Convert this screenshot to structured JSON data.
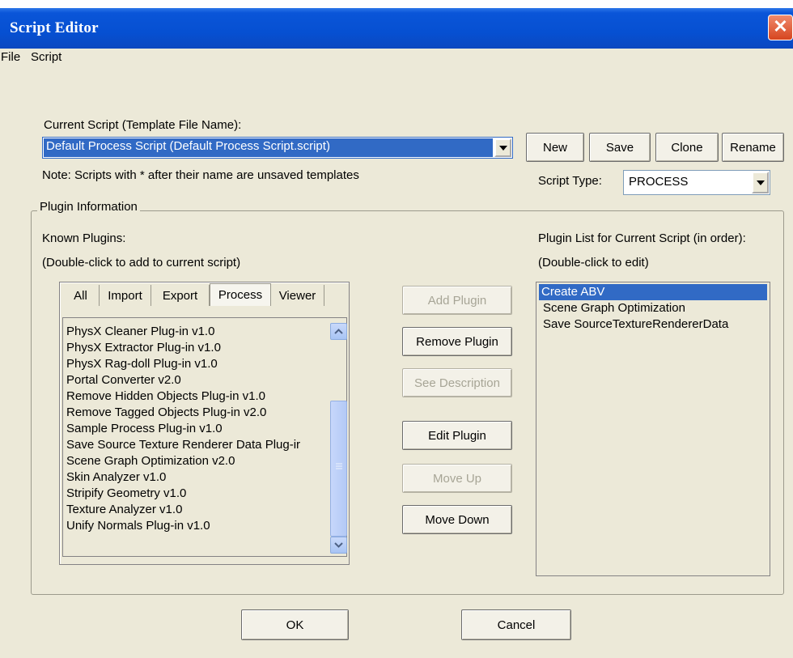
{
  "window": {
    "title": "Script Editor",
    "close_glyph": "✕"
  },
  "menu": [
    "File",
    "Script"
  ],
  "current_script": {
    "label": "Current Script (Template File Name):",
    "value": "Default Process Script   (Default Process Script.script)",
    "note": "Note: Scripts with * after their name are unsaved templates"
  },
  "script_buttons": {
    "new": "New",
    "save": "Save",
    "clone": "Clone",
    "rename": "Rename"
  },
  "script_type": {
    "label": "Script Type:",
    "value": "PROCESS"
  },
  "group": {
    "title": "Plugin Information"
  },
  "known": {
    "label_line1": "Known Plugins:",
    "label_line2": "(Double-click to add to current script)",
    "tabs": [
      "All",
      "Import",
      "Export",
      "Process",
      "Viewer"
    ],
    "active_tab": "Process",
    "items": [
      "PhysX Cleaner Plug-in  v1.0",
      "PhysX Extractor Plug-in  v1.0",
      "PhysX Rag-doll Plug-in  v1.0",
      "Portal Converter  v2.0",
      "Remove Hidden Objects Plug-in  v1.0",
      "Remove Tagged Objects Plug-in  v2.0",
      "Sample Process Plug-in  v1.0",
      "Save Source Texture Renderer Data Plug-ir",
      "Scene Graph Optimization  v2.0",
      "Skin Analyzer  v1.0",
      "Stripify Geometry  v1.0",
      "Texture Analyzer  v1.0",
      "Unify Normals Plug-in  v1.0"
    ]
  },
  "actions": {
    "add": "Add Plugin",
    "remove": "Remove Plugin",
    "describe": "See Description",
    "edit": "Edit Plugin",
    "up": "Move Up",
    "down": "Move Down"
  },
  "current_list": {
    "label_line1": "Plugin List for Current Script (in order):",
    "label_line2": "(Double-click to edit)",
    "items": [
      "Create ABV",
      "Scene Graph Optimization",
      "Save SourceTextureRendererData"
    ],
    "selected": "Create ABV"
  },
  "dialog_buttons": {
    "ok": "OK",
    "cancel": "Cancel"
  },
  "colors": {
    "titlebar": "#0650d2",
    "window_bg": "#ece9d8",
    "selection": "#316ac5",
    "close": "#d6451f"
  }
}
